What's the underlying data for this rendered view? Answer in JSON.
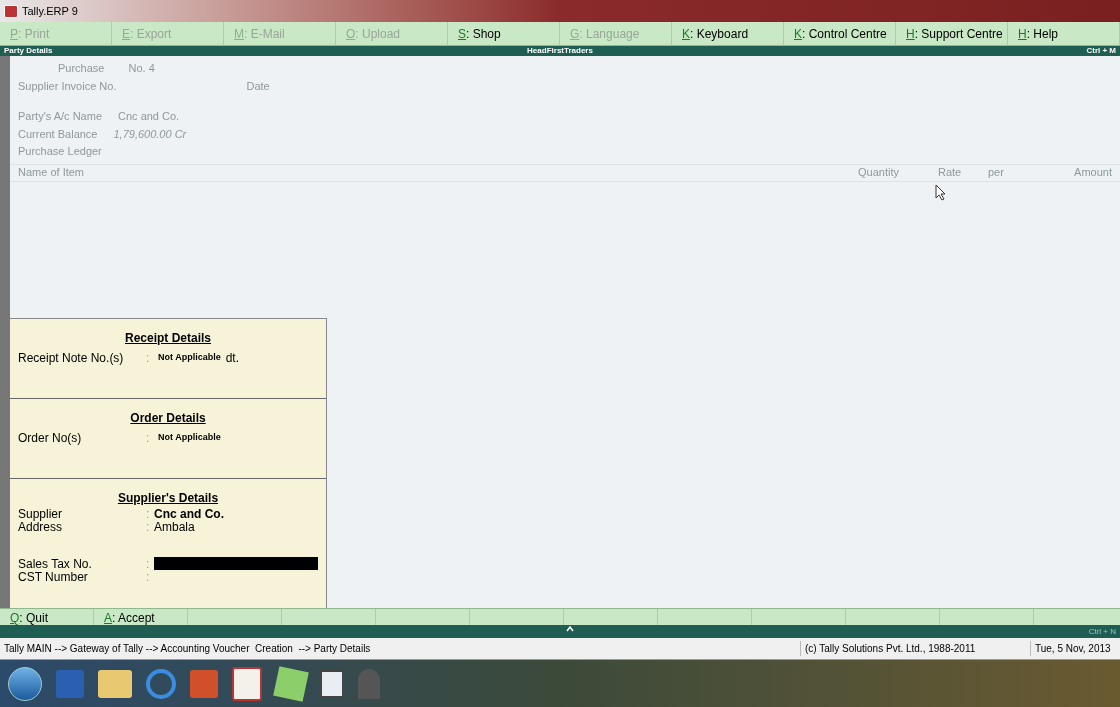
{
  "window": {
    "title": "Tally.ERP 9"
  },
  "menu_buttons": [
    {
      "key": "P",
      "label": ": Print",
      "disabled": true
    },
    {
      "key": "E",
      "label": ": Export",
      "disabled": true
    },
    {
      "key": "M",
      "label": ": E-Mail",
      "disabled": true
    },
    {
      "key": "O",
      "label": ": Upload",
      "disabled": true
    },
    {
      "key": "S",
      "label": ": Shop",
      "disabled": false
    },
    {
      "key": "G",
      "label": ": Language",
      "disabled": true
    },
    {
      "key": "K",
      "label": ": Keyboard",
      "disabled": false
    },
    {
      "key": "K",
      "label": ": Control Centre",
      "disabled": false
    },
    {
      "key": "H",
      "label": ": Support Centre",
      "disabled": false
    },
    {
      "key": "H",
      "label": ": Help",
      "disabled": false
    }
  ],
  "header_bar": {
    "left": "Party Details",
    "center": "HeadFirstTraders",
    "right": "Ctrl + M"
  },
  "voucher": {
    "type": "Purchase",
    "number": "No. 4",
    "supplier_invoice_label": "Supplier Invoice No.",
    "date_label": "Date",
    "party_label": "Party's A/c Name",
    "party_value": "Cnc and Co.",
    "balance_label": "Current Balance",
    "balance_value": "1,79,600.00 Cr",
    "ledger_label": "Purchase Ledger",
    "columns": [
      "Name of Item",
      "Quantity",
      "Rate",
      "per",
      "Amount"
    ]
  },
  "party_details": {
    "sections": [
      {
        "title": "Receipt Details",
        "rows": [
          {
            "label": "Receipt Note No.(s)",
            "separator": ":",
            "value": "Not Applicable",
            "suffix": "dt."
          }
        ]
      },
      {
        "title": "Order Details",
        "rows": [
          {
            "label": "Order No(s)",
            "separator": ":",
            "value": "Not Applicable"
          }
        ]
      },
      {
        "title": "Supplier's Details",
        "rows": [
          {
            "label": "Supplier",
            "separator": ":",
            "value": "Cnc and Co."
          },
          {
            "label": "Address",
            "separator": ":",
            "value": "Ambala"
          },
          {
            "label": "Sales Tax No.",
            "separator": ":",
            "value": "",
            "kind": "input"
          },
          {
            "label": "CST Number",
            "separator": ":"
          }
        ]
      }
    ]
  },
  "bottom_buttons": [
    {
      "key": "Q",
      "label": ": Quit"
    },
    {
      "key": "A",
      "label": ": Accept"
    }
  ],
  "bottom_bar": {
    "right": "Ctrl + N"
  },
  "status_bar": {
    "path": "Tally MAIN --> Gateway of Tally --> Accounting Voucher  Creation  --> Party Details",
    "copyright": "(c) Tally Solutions Pvt. Ltd., 1988-2011",
    "date": "Tue, 5 Nov, 2013"
  }
}
